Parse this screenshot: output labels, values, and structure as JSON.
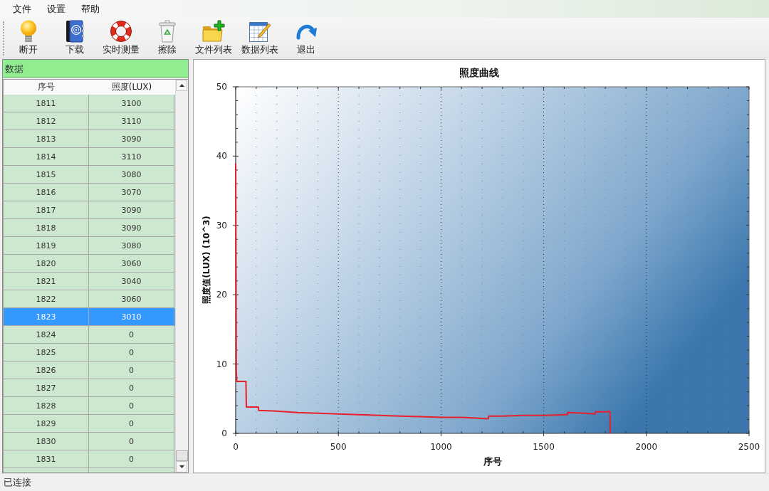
{
  "menu": [
    "文件",
    "设置",
    "帮助"
  ],
  "toolbar": [
    {
      "kind": "bulb",
      "label": "断开"
    },
    {
      "kind": "book",
      "label": "下载"
    },
    {
      "kind": "lifebuoy",
      "label": "实时测量"
    },
    {
      "kind": "bin",
      "label": "擦除"
    },
    {
      "kind": "folder",
      "label": "文件列表"
    },
    {
      "kind": "table",
      "label": "数据列表"
    },
    {
      "kind": "redo",
      "label": "退出"
    }
  ],
  "data_panel": {
    "title": "数据",
    "columns": [
      "序号",
      "照度(LUX)"
    ],
    "rows": [
      {
        "number": "1811",
        "lux": "3100",
        "selected": false
      },
      {
        "number": "1812",
        "lux": "3110",
        "selected": false
      },
      {
        "number": "1813",
        "lux": "3090",
        "selected": false
      },
      {
        "number": "1814",
        "lux": "3110",
        "selected": false
      },
      {
        "number": "1815",
        "lux": "3080",
        "selected": false
      },
      {
        "number": "1816",
        "lux": "3070",
        "selected": false
      },
      {
        "number": "1817",
        "lux": "3090",
        "selected": false
      },
      {
        "number": "1818",
        "lux": "3090",
        "selected": false
      },
      {
        "number": "1819",
        "lux": "3080",
        "selected": false
      },
      {
        "number": "1820",
        "lux": "3060",
        "selected": false
      },
      {
        "number": "1821",
        "lux": "3040",
        "selected": false
      },
      {
        "number": "1822",
        "lux": "3060",
        "selected": false
      },
      {
        "number": "1823",
        "lux": "3010",
        "selected": true
      },
      {
        "number": "1824",
        "lux": "0",
        "selected": false
      },
      {
        "number": "1825",
        "lux": "0",
        "selected": false
      },
      {
        "number": "1826",
        "lux": "0",
        "selected": false
      },
      {
        "number": "1827",
        "lux": "0",
        "selected": false
      },
      {
        "number": "1828",
        "lux": "0",
        "selected": false
      },
      {
        "number": "1829",
        "lux": "0",
        "selected": false
      },
      {
        "number": "1830",
        "lux": "0",
        "selected": false
      },
      {
        "number": "1831",
        "lux": "0",
        "selected": false
      }
    ]
  },
  "chart": {
    "chart_data": {
      "type": "line",
      "title": "照度曲线",
      "xlabel": "序号",
      "ylabel": "照度值(LUX) (10^3)",
      "xlim": [
        0,
        2500
      ],
      "ylim": [
        0,
        50
      ],
      "xticks": [
        0,
        500,
        1000,
        1500,
        2000,
        2500
      ],
      "yticks": [
        0,
        10,
        20,
        30,
        40,
        50
      ],
      "grid": "x",
      "color": "#e8202a",
      "x": [
        0,
        1,
        3,
        5,
        50,
        52,
        110,
        112,
        200,
        300,
        400,
        500,
        600,
        700,
        800,
        900,
        1000,
        1100,
        1230,
        1232,
        1300,
        1400,
        1500,
        1600,
        1615,
        1617,
        1700,
        1750,
        1752,
        1811,
        1818,
        1822,
        1823,
        1824
      ],
      "values": [
        39,
        30,
        9,
        7.5,
        7.5,
        3.8,
        3.8,
        3.3,
        3.2,
        3.0,
        2.9,
        2.8,
        2.7,
        2.6,
        2.5,
        2.4,
        2.3,
        2.3,
        2.1,
        2.5,
        2.5,
        2.6,
        2.6,
        2.7,
        2.7,
        3.0,
        2.9,
        2.8,
        3.1,
        3.1,
        3.2,
        3.1,
        3.0,
        0
      ]
    }
  },
  "status_bar": "已连接"
}
